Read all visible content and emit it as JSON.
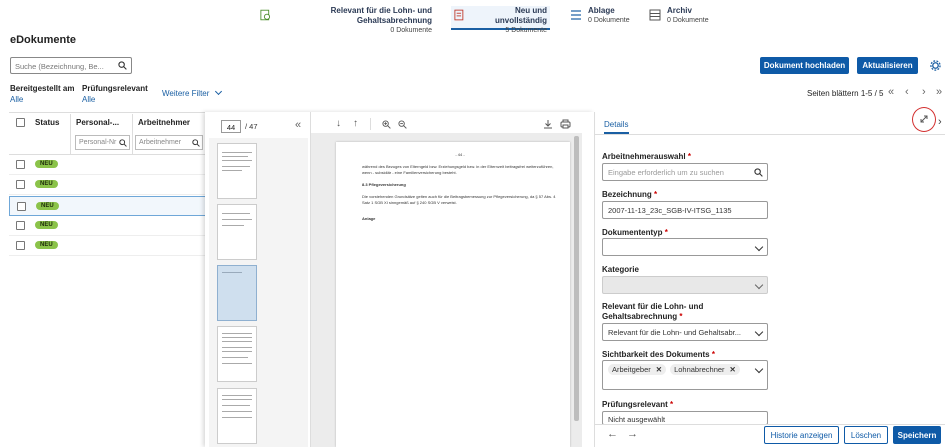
{
  "tabs": [
    {
      "title": "Relevant für die Lohn- und Gehaltsabrechnung",
      "count": "0 Dokumente"
    },
    {
      "title": "Neu und unvollständig",
      "count": "5 Dokumente"
    },
    {
      "title": "Ablage",
      "count": "0 Dokumente"
    },
    {
      "title": "Archiv",
      "count": "0 Dokumente"
    }
  ],
  "page_title": "eDokumente",
  "search": {
    "placeholder": "Suche (Bezeichnung, Be..."
  },
  "buttons": {
    "upload": "Dokument hochladen",
    "refresh": "Aktualisieren",
    "history": "Historie anzeigen",
    "delete": "Löschen",
    "save": "Speichern"
  },
  "filters": [
    {
      "label": "Bereitgestellt am",
      "value": "Alle"
    },
    {
      "label": "Prüfungsrelevant",
      "value": "Alle"
    }
  ],
  "more_filters": "Weitere Filter",
  "pagination": "Seiten blättern 1-5 / 5",
  "table": {
    "columns": [
      "Status",
      "Personal-...",
      "Arbeitnehmer"
    ],
    "filter_placeholders": [
      "Personal-Nr",
      "Arbeitnehmer"
    ],
    "rows": [
      {
        "status": "NEU"
      },
      {
        "status": "NEU"
      },
      {
        "status": "NEU"
      },
      {
        "status": "NEU"
      },
      {
        "status": "NEU"
      }
    ]
  },
  "viewer": {
    "page": "44",
    "total": "/ 47",
    "doc_heading": "- 44 -",
    "doc_p1": "während des Bezuges von Elterngeld bzw. Erziehungsgeld bzw. in der Elternzeit beitragsfrei weiterzuführen, wenn - subsidiär - eine Familienversicherung besteht.",
    "doc_h2": "8.3     Pflegeversicherung",
    "doc_p2": "Die vorstehenden Grundsätze gelten auch für die Beitragsbemessung zur Pflegeversicherung, da § 57 Abs. 4 Satz 1 SGB XI sinngemäß auf § 240 SGB V verweist.",
    "doc_h3": "Anlage"
  },
  "details": {
    "tab": "Details",
    "fields": {
      "arbeitnehmer": {
        "label": "Arbeitnehmerauswahl",
        "placeholder": "Eingabe erforderlich um zu suchen"
      },
      "bezeichnung": {
        "label": "Bezeichnung",
        "value": "2007-11-13_23c_SGB-IV-ITSG_1135"
      },
      "dokumenttyp": {
        "label": "Dokumententyp",
        "value": ""
      },
      "kategorie": {
        "label": "Kategorie",
        "value": ""
      },
      "relevant": {
        "label1": "Relevant für die Lohn- und",
        "label2": "Gehaltsabrechnung",
        "value": "Relevant für die Lohn- und Gehaltsabr..."
      },
      "sichtbarkeit": {
        "label": "Sichtbarkeit des Dokuments",
        "chips": [
          "Arbeitgeber",
          "Lohnabrechner"
        ]
      },
      "pruefung": {
        "label": "Prüfungsrelevant",
        "value": "Nicht ausgewählt"
      }
    },
    "req": "*"
  },
  "colors": {
    "accent": "#0e5aa7",
    "badge": "#8bc34a",
    "highlight": "#d32f2f"
  }
}
